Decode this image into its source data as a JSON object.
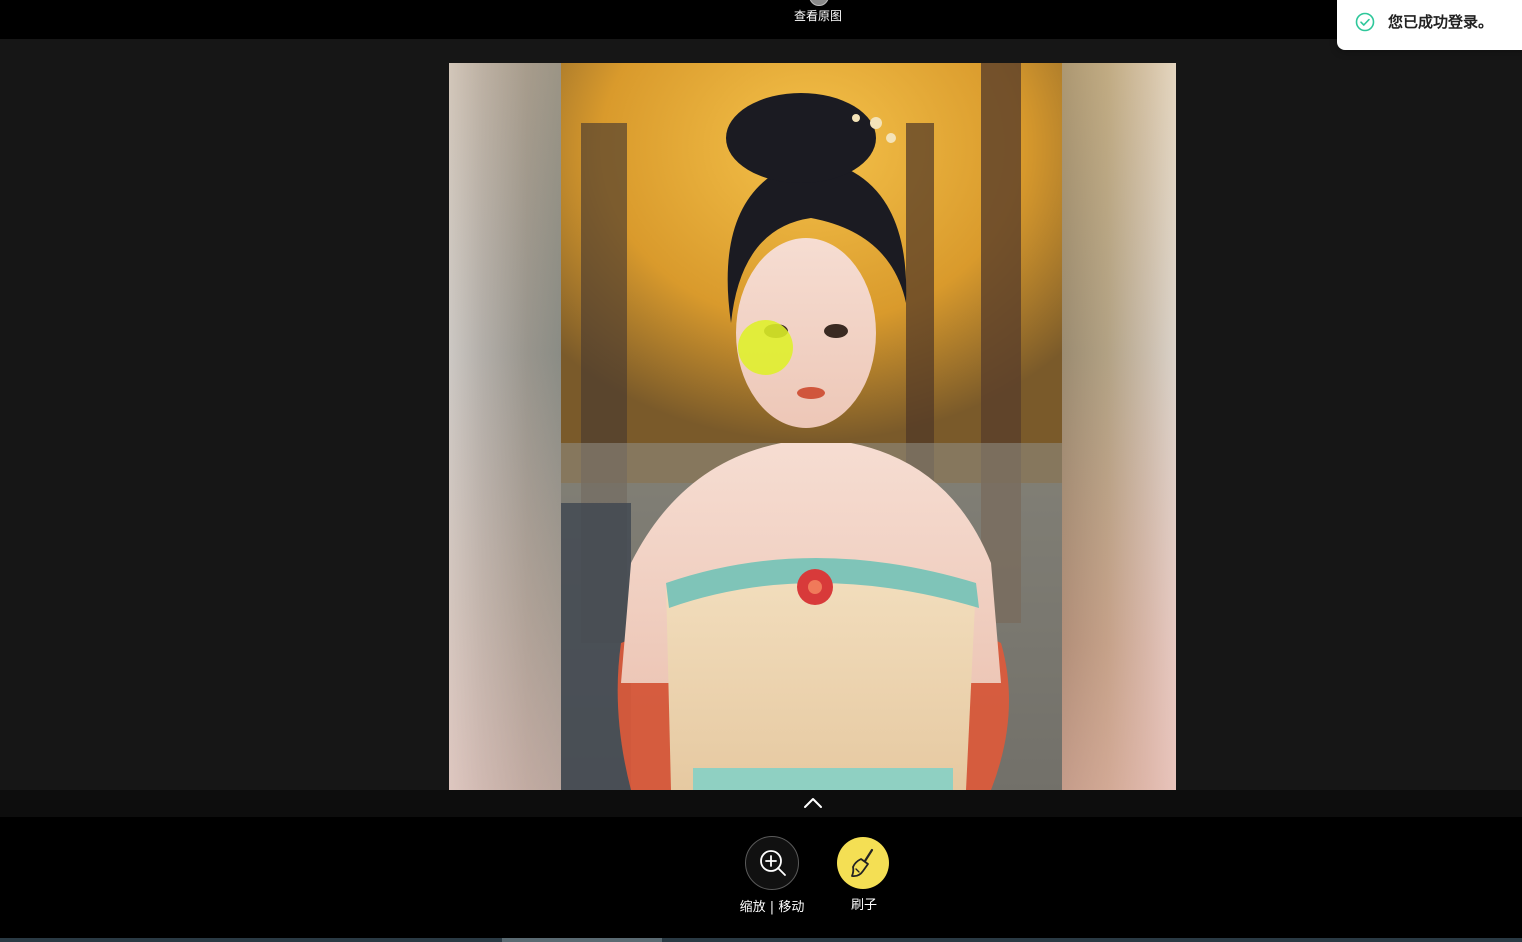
{
  "header": {
    "view_original_label": "查看原图",
    "view_original_icon": "eye-icon"
  },
  "toast": {
    "message": "您已成功登录。",
    "icon": "check-circle-icon",
    "accent": "#2ec79a"
  },
  "editor": {
    "image_alt": "Portrait of a woman in traditional Chinese dress with autumn trees",
    "brush_color": "#def028"
  },
  "toolbar": {
    "expand_icon": "chevron-up-icon",
    "tools": [
      {
        "label": "缩放 | 移动",
        "icon": "zoom-in-icon",
        "active": false
      },
      {
        "label": "刷子",
        "icon": "brush-icon",
        "active": true,
        "color": "#f4df54"
      }
    ]
  }
}
